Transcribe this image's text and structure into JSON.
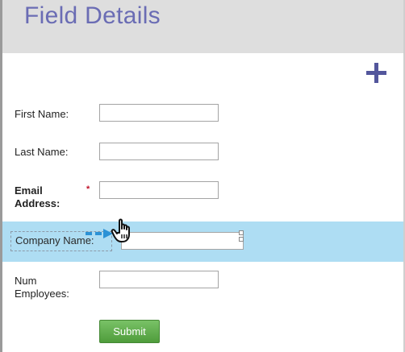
{
  "header": {
    "title": "Field Details"
  },
  "toolbar": {
    "add_icon": "plus-icon"
  },
  "form": {
    "fields": [
      {
        "label": "First Name:",
        "value": ""
      },
      {
        "label": "Last Name:",
        "value": ""
      },
      {
        "label_line1": "Email",
        "label_line2": "Address:",
        "value": "",
        "required_marker": "*"
      },
      {
        "label": "Company Name:",
        "value": ""
      },
      {
        "label_line1": "Num",
        "label_line2": "Employees:",
        "value": ""
      }
    ],
    "submit_label": "Submit"
  },
  "drag": {
    "arrow_icon": "drag-arrow-icon",
    "cursor_icon": "hand-cursor-icon",
    "highlight_color": "#aeddf3"
  },
  "colors": {
    "title": "#6a6cb4",
    "plus": "#53569c",
    "required": "#c0142b",
    "submit": "#5aa547"
  }
}
